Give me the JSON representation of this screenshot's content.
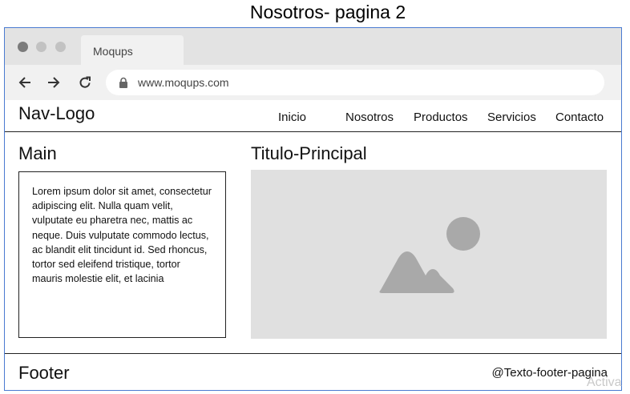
{
  "page_title": "Nosotros- pagina 2",
  "browser": {
    "tab_label": "Moqups",
    "url": "www.moqups.com",
    "controls": [
      "back-arrow-icon",
      "forward-arrow-icon",
      "reload-icon",
      "lock-icon"
    ]
  },
  "navbar": {
    "logo": "Nav-Logo",
    "links": [
      "Inicio",
      "Nosotros",
      "Productos",
      "Servicios",
      "Contacto"
    ]
  },
  "main": {
    "label": "Main",
    "text": "Lorem ipsum dolor sit amet, consectetur adipiscing elit. Nulla quam velit, vulputate eu pharetra nec, mattis ac neque. Duis vulputate commodo lectus, ac blandit elit tincidunt id. Sed rhoncus, tortor sed eleifend tristique, tortor mauris molestie elit, et lacinia",
    "title": "Titulo-Principal",
    "image_icon": "image-placeholder-icon"
  },
  "footer": {
    "label": "Footer",
    "text": "@Texto-footer-pagina"
  },
  "watermark": "Activa",
  "colors": {
    "frame_border": "#4a7bd1",
    "tabbar": "#e3e3e3",
    "urlbar": "#f1f1f1",
    "image_placeholder": "#e0e0e0",
    "image_glyph": "#a9a9a9"
  }
}
